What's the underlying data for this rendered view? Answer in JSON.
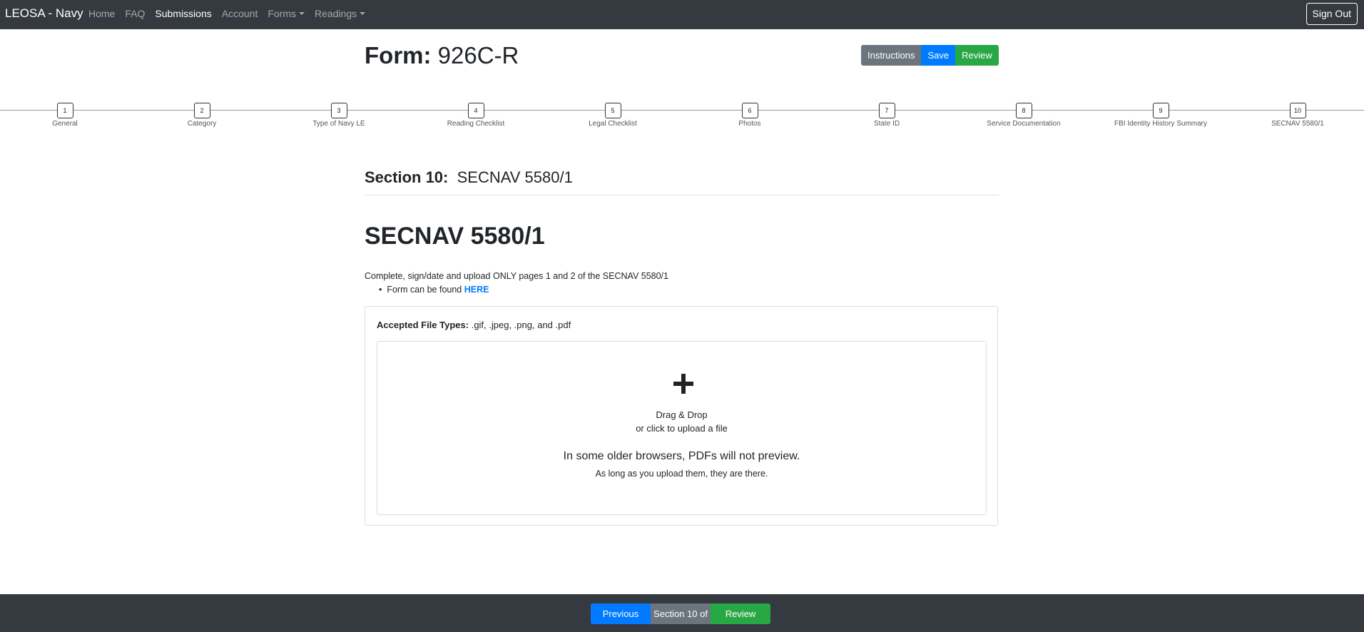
{
  "navbar": {
    "brand": "LEOSA - Navy",
    "links": [
      "Home",
      "FAQ",
      "Submissions",
      "Account",
      "Forms",
      "Readings"
    ],
    "sign_out": "Sign Out"
  },
  "header": {
    "form_label": "Form:",
    "form_value": "926C-R",
    "buttons": {
      "instructions": "Instructions",
      "save": "Save",
      "review": "Review"
    }
  },
  "steps": [
    {
      "number": "1",
      "label": "General"
    },
    {
      "number": "2",
      "label": "Category"
    },
    {
      "number": "3",
      "label": "Type of Navy LE"
    },
    {
      "number": "4",
      "label": "Reading Checklist"
    },
    {
      "number": "5",
      "label": "Legal Checklist"
    },
    {
      "number": "6",
      "label": "Photos"
    },
    {
      "number": "7",
      "label": "State ID"
    },
    {
      "number": "8",
      "label": "Service Documentation"
    },
    {
      "number": "9",
      "label": "FBI Identity History Summary"
    },
    {
      "number": "10",
      "label": "SECNAV 5580/1"
    }
  ],
  "section": {
    "label": "Section 10:",
    "name": "SECNAV 5580/1",
    "heading": "SECNAV 5580/1",
    "instructions": "Complete, sign/date and upload ONLY pages 1 and 2 of the SECNAV 5580/1",
    "bullet_text": "Form can be found",
    "bullet_link": "HERE"
  },
  "upload": {
    "accepted_label": "Accepted File Types:",
    "accepted_types": ".gif, .jpeg, .png, and .pdf",
    "drag_drop": "Drag & Drop",
    "click_upload": "or click to upload a file",
    "note_main": "In some older browsers, PDFs will not preview.",
    "note_sub": "As long as you upload them, they are there."
  },
  "footer": {
    "previous": "Previous",
    "section_indicator": "Section 10 of",
    "review": "Review"
  },
  "colors": {
    "navbar": "#343a40",
    "primary": "#007bff",
    "secondary": "#6c757d",
    "success": "#28a745"
  }
}
